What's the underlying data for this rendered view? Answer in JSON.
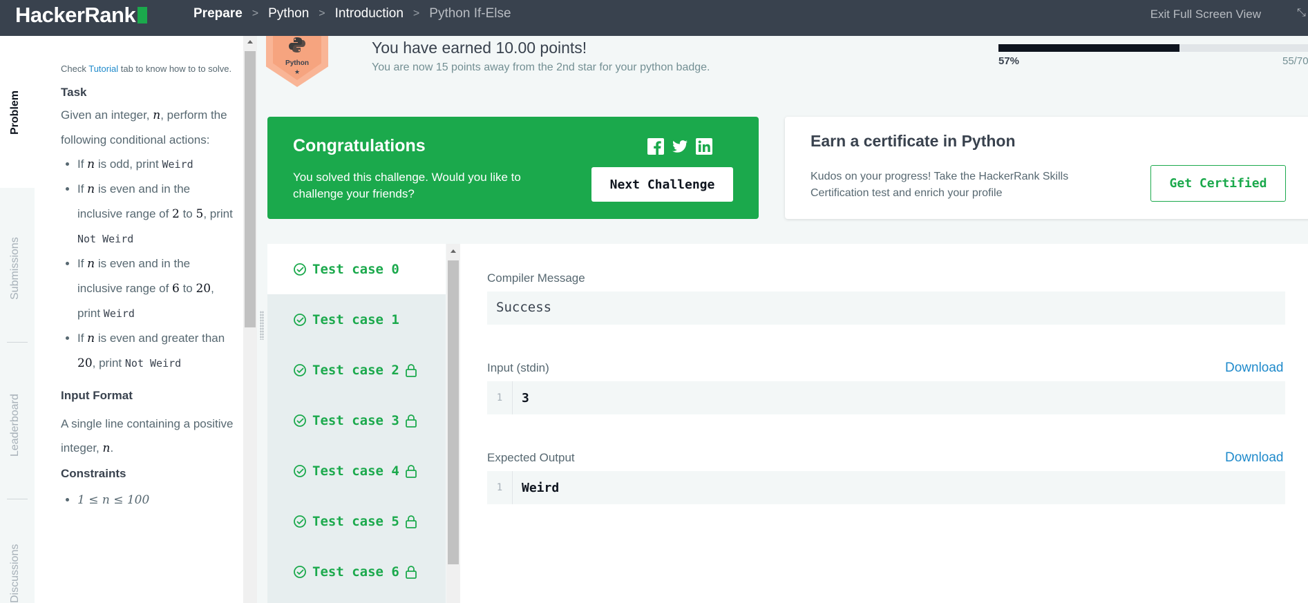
{
  "nav": {
    "logo": "HackerRank",
    "breadcrumbs": [
      "Prepare",
      "Python",
      "Introduction",
      "Python If-Else"
    ],
    "exit_fullscreen": "Exit Full Screen View"
  },
  "vtabs": [
    "Problem",
    "Submissions",
    "Leaderboard",
    "Discussions"
  ],
  "problem": {
    "intro_pre": "Check ",
    "intro_link": "Tutorial",
    "intro_post": " tab to know how to to solve.",
    "task_heading": "Task",
    "task_text_pre": "Given an integer, ",
    "task_var": "n",
    "task_text_post": ", perform the following conditional actions:",
    "rules": [
      {
        "pre": "If ",
        "var": "n",
        "mid": " is odd, print ",
        "code": "Weird"
      },
      {
        "pre": "If ",
        "var": "n",
        "mid": " is even and in the inclusive range of ",
        "a": "2",
        "to": " to ",
        "b": "5",
        "post": ", print ",
        "code": "Not Weird"
      },
      {
        "pre": "If ",
        "var": "n",
        "mid": " is even and in the inclusive range of ",
        "a": "6",
        "to": " to ",
        "b": "20",
        "post": ", print ",
        "code": "Weird"
      },
      {
        "pre": "If ",
        "var": "n",
        "mid": " is even and greater than ",
        "b": "20",
        "post": ", print ",
        "code": "Not Weird"
      }
    ],
    "input_heading": "Input Format",
    "input_text_pre": "A single line containing a positive integer, ",
    "input_var": "n",
    "input_text_post": ".",
    "constraints_heading": "Constraints",
    "constraint": "1 ≤ n ≤ 100"
  },
  "badge": {
    "label": "Python",
    "star": "★"
  },
  "points": {
    "title": "You have earned 10.00 points!",
    "subtitle": "You are now 15 points away from the 2nd star for your python badge.",
    "progress_fraction": 0.57,
    "progress_pct": "57%",
    "progress_count": "55/70"
  },
  "congrats": {
    "title": "Congratulations",
    "text": "You solved this challenge. Would you like to challenge your friends?",
    "next_button": "Next Challenge",
    "accent": "#1ba94c"
  },
  "cert": {
    "title": "Earn a certificate in Python",
    "text": "Kudos on your progress! Take the HackerRank Skills Certification test and enrich your profile",
    "button": "Get Certified"
  },
  "test_cases": [
    {
      "label": "Test case 0",
      "locked": false
    },
    {
      "label": "Test case 1",
      "locked": false
    },
    {
      "label": "Test case 2",
      "locked": true
    },
    {
      "label": "Test case 3",
      "locked": true
    },
    {
      "label": "Test case 4",
      "locked": true
    },
    {
      "label": "Test case 5",
      "locked": true
    },
    {
      "label": "Test case 6",
      "locked": true
    }
  ],
  "detail": {
    "compiler_label": "Compiler Message",
    "compiler_msg": "Success",
    "input_label": "Input (stdin)",
    "download": "Download",
    "input_line_no": "1",
    "input_value": "3",
    "expected_label": "Expected Output",
    "expected_line_no": "1",
    "expected_value": "Weird"
  }
}
